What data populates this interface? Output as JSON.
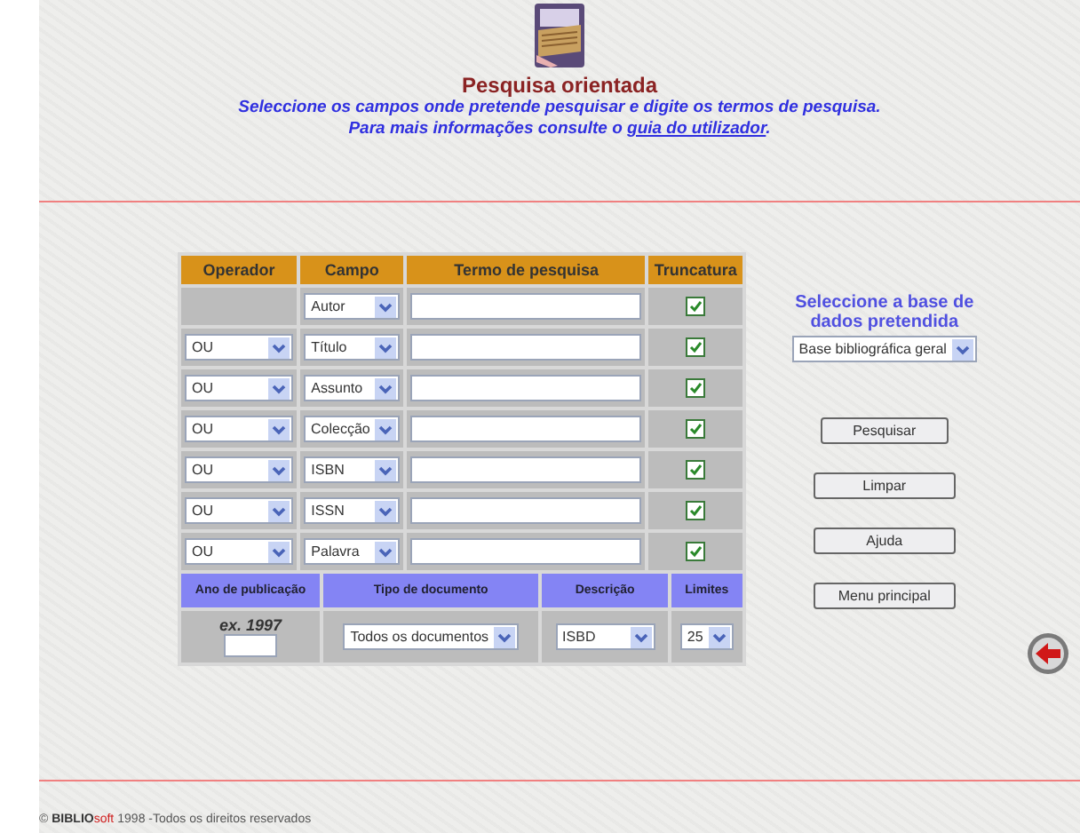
{
  "header": {
    "title": "Pesquisa orientada",
    "instruction": "Seleccione os campos onde pretende pesquisar e digite os termos de pesquisa.",
    "help_prefix": "Para mais informações consulte o",
    "help_link": "guia do utilizador",
    "help_suffix": "."
  },
  "table": {
    "columns": [
      "Operador",
      "Campo",
      "Termo de pesquisa",
      "Truncatura"
    ],
    "rows": [
      {
        "field": "Autor",
        "truncate": true
      },
      {
        "operator": "OU",
        "field": "Título",
        "truncate": true
      },
      {
        "operator": "OU",
        "field": "Assunto",
        "truncate": true
      },
      {
        "operator": "OU",
        "field": "Colecção",
        "truncate": true
      },
      {
        "operator": "OU",
        "field": "ISBN",
        "truncate": true
      },
      {
        "operator": "OU",
        "field": "ISSN",
        "truncate": true
      },
      {
        "operator": "OU",
        "field": "Palavra",
        "truncate": true
      }
    ]
  },
  "limits": {
    "columns": [
      "Ano de publicação",
      "Tipo de documento",
      "Descrição",
      "Limites"
    ],
    "year_hint": "ex. 1997",
    "document_type": "Todos os documentos",
    "description": "ISBD",
    "limit": "25"
  },
  "database": {
    "label": "Seleccione a base de dados pretendida",
    "value": "Base bibliográfica geral"
  },
  "buttons": [
    "Pesquisar",
    "Limpar",
    "Ajuda",
    "Menu principal"
  ],
  "footer": {
    "copyright": "©",
    "brand": "BIBLIO",
    "brand_accent": "soft",
    "text": "1998 -Todos os direitos reservados"
  }
}
